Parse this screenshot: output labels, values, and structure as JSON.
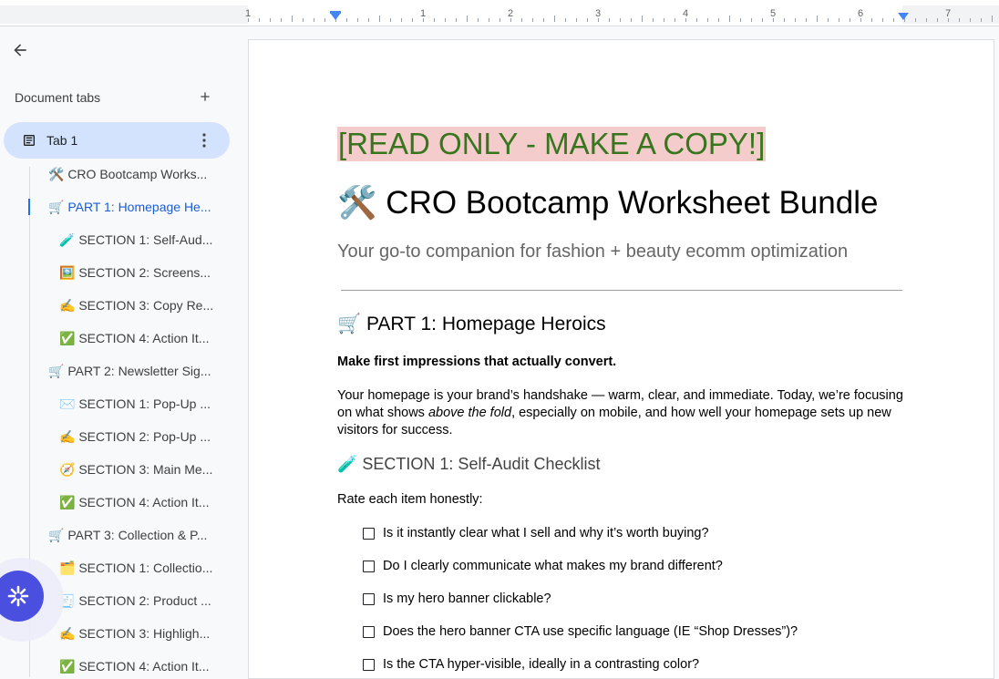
{
  "ruler": {
    "numbers": [
      "1",
      "1",
      "2",
      "3",
      "4",
      "5",
      "6",
      "7"
    ]
  },
  "sidebar": {
    "back_icon": "arrow-back-icon",
    "tabs_title": "Document tabs",
    "add_icon": "plus-icon",
    "tab": {
      "label": "Tab 1",
      "icon": "document-icon",
      "more_icon": "more-vert-icon"
    },
    "outline": [
      {
        "label": "🛠️ CRO Bootcamp Works...",
        "level": 1,
        "active": false
      },
      {
        "label": "🛒 PART 1: Homepage He...",
        "level": 1,
        "active": true
      },
      {
        "label": "🧪 SECTION 1: Self-Aud...",
        "level": 2,
        "active": false
      },
      {
        "label": "🖼️ SECTION 2: Screens...",
        "level": 2,
        "active": false
      },
      {
        "label": "✍️ SECTION 3: Copy Re...",
        "level": 2,
        "active": false
      },
      {
        "label": "✅ SECTION 4: Action It...",
        "level": 2,
        "active": false
      },
      {
        "label": "🛒 PART 2: Newsletter Sig...",
        "level": 1,
        "active": false
      },
      {
        "label": "✉️ SECTION 1: Pop-Up ...",
        "level": 2,
        "active": false
      },
      {
        "label": "✍️ SECTION 2: Pop-Up ...",
        "level": 2,
        "active": false
      },
      {
        "label": "🧭 SECTION 3: Main Me...",
        "level": 2,
        "active": false
      },
      {
        "label": "✅ SECTION 4: Action It...",
        "level": 2,
        "active": false
      },
      {
        "label": "🛒 PART 3: Collection & P...",
        "level": 1,
        "active": false
      },
      {
        "label": "🗂️ SECTION 1: Collectio...",
        "level": 2,
        "active": false
      },
      {
        "label": "🧾 SECTION 2: Product ...",
        "level": 2,
        "active": false
      },
      {
        "label": "✍️ SECTION 3: Highligh...",
        "level": 2,
        "active": false
      },
      {
        "label": "✅ SECTION 4: Action It...",
        "level": 2,
        "active": false
      }
    ],
    "float_icon": "sparkle-icon"
  },
  "document": {
    "read_only_banner": "[READ ONLY - MAKE A COPY!]",
    "title": "🛠️ CRO Bootcamp Worksheet Bundle",
    "subtitle": "Your go-to companion for fashion + beauty ecomm optimization",
    "part1_heading": "🛒 PART 1: Homepage Heroics",
    "bold_intro": "Make first impressions that actually convert.",
    "para_part1": "Your homepage is your brand’s handshake — warm, clear, and immediate. Today, we’re focusing on what shows ",
    "para_italic": "above the fold",
    "para_part2": ", especially on mobile, and how well your homepage sets up new visitors for success.",
    "section1_heading": "🧪 SECTION 1: Self-Audit Checklist",
    "rate_text": "Rate each item honestly:",
    "checklist": [
      "Is it instantly clear what I sell and why it’s worth buying?",
      "Do I clearly communicate what makes my brand different?",
      "Is my hero banner clickable?",
      "Does the hero banner CTA use specific language (IE “Shop Dresses”)?",
      "Is the CTA hyper-visible, ideally in a contrasting color?"
    ]
  },
  "colors": {
    "banner_text": "#38761d",
    "banner_bg": "#f4cccc",
    "active_tab_bg": "#d3e3fd",
    "active_link": "#1a5dd6",
    "float_button": "#4a4fe0"
  }
}
